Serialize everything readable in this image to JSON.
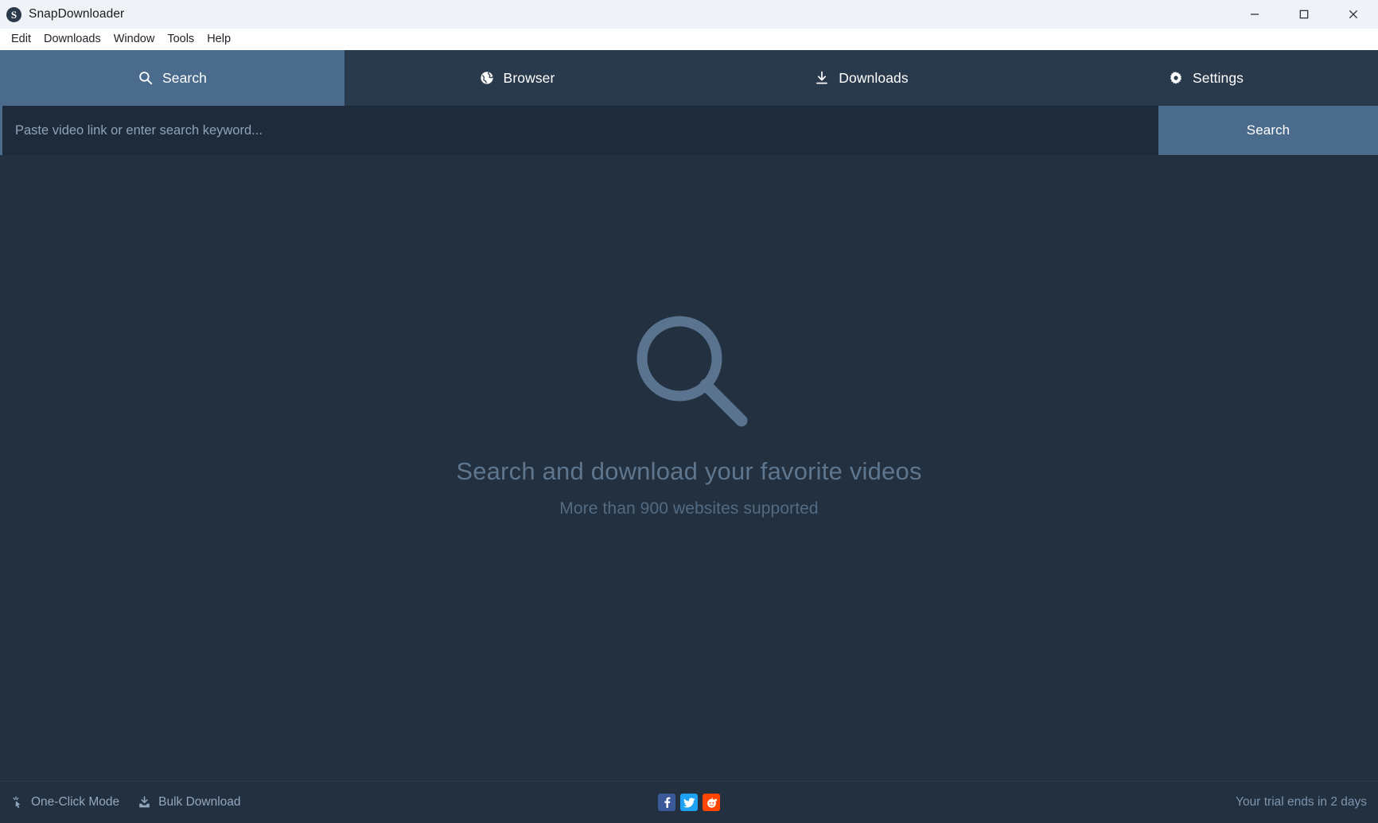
{
  "window": {
    "title": "SnapDownloader",
    "logo_letter": "S",
    "controls": [
      {
        "name": "minimize",
        "label": "Minimize"
      },
      {
        "name": "maximize",
        "label": "Maximize"
      },
      {
        "name": "close",
        "label": "Close"
      }
    ]
  },
  "menubar": {
    "items": [
      {
        "label": "Edit"
      },
      {
        "label": "Downloads"
      },
      {
        "label": "Window"
      },
      {
        "label": "Tools"
      },
      {
        "label": "Help"
      }
    ]
  },
  "tabs": [
    {
      "label": "Search",
      "icon": "search-icon",
      "active": true
    },
    {
      "label": "Browser",
      "icon": "globe-icon",
      "active": false
    },
    {
      "label": "Downloads",
      "icon": "download-icon",
      "active": false
    },
    {
      "label": "Settings",
      "icon": "gear-icon",
      "active": false
    }
  ],
  "search": {
    "placeholder": "Paste video link or enter search keyword...",
    "value": "",
    "button_label": "Search"
  },
  "empty_state": {
    "icon": "magnifier-icon",
    "title": "Search and download your favorite videos",
    "subtitle": "More than 900 websites supported"
  },
  "statusbar": {
    "one_click_label": "One-Click Mode",
    "bulk_label": "Bulk Download",
    "trial_text": "Your trial ends in 2 days",
    "social": [
      {
        "name": "facebook-icon",
        "letter": "f"
      },
      {
        "name": "twitter-icon",
        "letter": "t"
      },
      {
        "name": "reddit-icon",
        "letter": "r"
      }
    ]
  },
  "colors": {
    "titlebar_bg": "#eff3f8",
    "menubar_bg": "#ffffff",
    "tabbar_bg": "#2a3a4d",
    "accent": "#4a6b8c",
    "main_bg": "#22303f",
    "input_bg": "#1e2b3a",
    "empty_icon": "#5a7490",
    "facebook": "#3b5998",
    "twitter": "#1da1f2",
    "reddit": "#ff4500"
  }
}
